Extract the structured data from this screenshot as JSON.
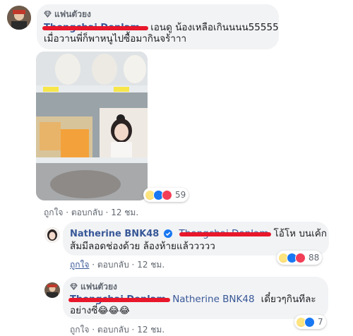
{
  "colors": {
    "link": "#385898",
    "redact": "#e8172b",
    "bubble": "#f2f3f5",
    "meta": "#616770"
  },
  "comments": [
    {
      "badge_icon": "diamond-icon",
      "badge": "แฟนตัวยง",
      "name": "Thongchai Donlam",
      "text_line1": "เอนดู น้องเหลือเกินนนน55555",
      "text_line2": "เมื่อวานพี่ก็พาหนูไปซื้อมากินจร้าาา",
      "reactions": [
        "haha",
        "like",
        "love"
      ],
      "reaction_count": "59",
      "like_label": "ถูกใจ",
      "reply_label": "ตอบกลับ",
      "time": "12 ชม."
    },
    {
      "name": "Natherine BNK48",
      "verified_icon": "verified-badge-icon",
      "tag": "Thongchai Donlam",
      "text_line1": "โอ้โห บนเค้ก",
      "text_line2": "ส้มมีลอดช่องด้วย ล้องห้ายแล้ววววว",
      "reactions": [
        "haha",
        "like",
        "love"
      ],
      "reaction_count": "88",
      "like_label": "ถูกใจ",
      "reply_label": "ตอบกลับ",
      "time": "12 ชม."
    },
    {
      "badge_icon": "diamond-icon",
      "badge": "แฟนตัวยง",
      "name": "Thongchai Donlam",
      "tag": "Natherine BNK48",
      "text_line1": "เดี๋ยวๆกินทีละ",
      "text_line2": "อย่างซี่",
      "emoji_line": "😂😂😂",
      "reactions": [
        "haha",
        "like"
      ],
      "reaction_count": "7",
      "like_label": "ถูกใจ",
      "reply_label": "ตอบกลับ",
      "time": "12 ชม."
    }
  ]
}
